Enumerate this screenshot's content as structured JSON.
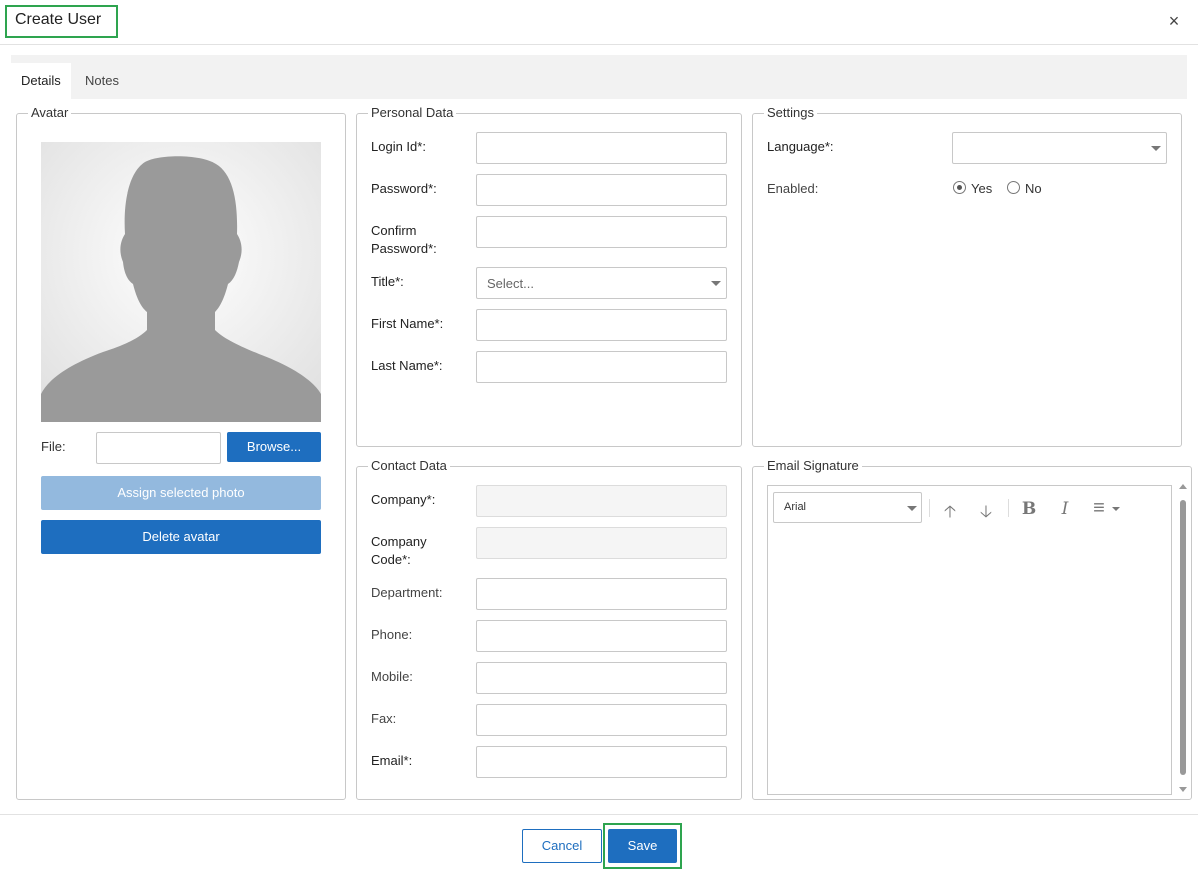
{
  "dialog": {
    "title": "Create User",
    "close_icon": "×"
  },
  "tabs": [
    {
      "label": "Details"
    },
    {
      "label": "Notes"
    }
  ],
  "avatar": {
    "legend": "Avatar",
    "file_label": "File:",
    "file_value": "",
    "browse_label": "Browse...",
    "assign_label": "Assign selected photo",
    "delete_label": "Delete avatar"
  },
  "personal": {
    "legend": "Personal Data",
    "login_label": "Login Id*:",
    "password_label": "Password*:",
    "confirm_label_1": "Confirm",
    "confirm_label_2": "Password*:",
    "title_label": "Title*:",
    "title_value": "Select...",
    "first_label": "First Name*:",
    "last_label": "Last Name*:"
  },
  "settings": {
    "legend": "Settings",
    "language_label": "Language*:",
    "language_value": "",
    "enabled_label": "Enabled:",
    "yes_label": "Yes",
    "no_label": "No",
    "enabled_value": "Yes"
  },
  "contact": {
    "legend": "Contact Data",
    "company_label": "Company*:",
    "company_code_label_1": "Company",
    "company_code_label_2": "Code*:",
    "department_label": "Department:",
    "phone_label": "Phone:",
    "mobile_label": "Mobile:",
    "fax_label": "Fax:",
    "email_label": "Email*:"
  },
  "signature": {
    "legend": "Email Signature",
    "font_value": "Arial",
    "tools": {
      "up": "🡡",
      "down": "🡣",
      "bold": "B",
      "italic": "I",
      "align": "≡"
    }
  },
  "footer": {
    "cancel_label": "Cancel",
    "save_label": "Save"
  },
  "colors": {
    "primary": "#1e6ebf",
    "highlight": "#2ea44f"
  }
}
